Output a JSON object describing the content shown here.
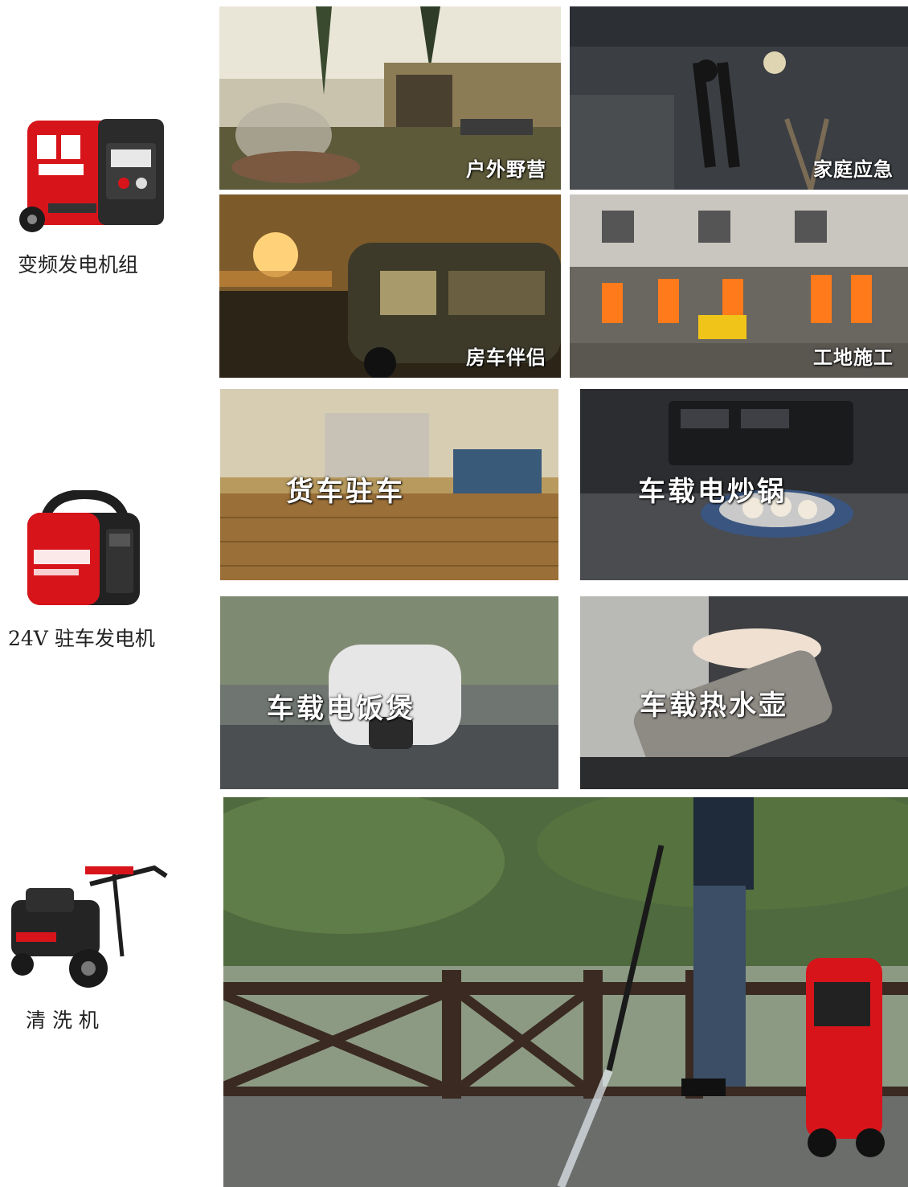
{
  "products": [
    {
      "label": "变频发电机组",
      "image_icon": "inverter-generator-icon"
    },
    {
      "label": "24V 驻车发电机",
      "image_icon": "parking-generator-icon"
    },
    {
      "label": "清 洗 机",
      "image_icon": "pressure-washer-icon"
    }
  ],
  "scenes": {
    "camping": "户外野营",
    "home_emergency": "家庭应急",
    "rv": "房车伴侣",
    "construction": "工地施工",
    "truck_parking": "货车驻车",
    "wok": "车载电炒锅",
    "rice_cooker": "车载电饭煲",
    "kettle": "车载热水壶"
  },
  "colors": {
    "brand_red": "#d8141b",
    "caption": "#ffffff"
  }
}
